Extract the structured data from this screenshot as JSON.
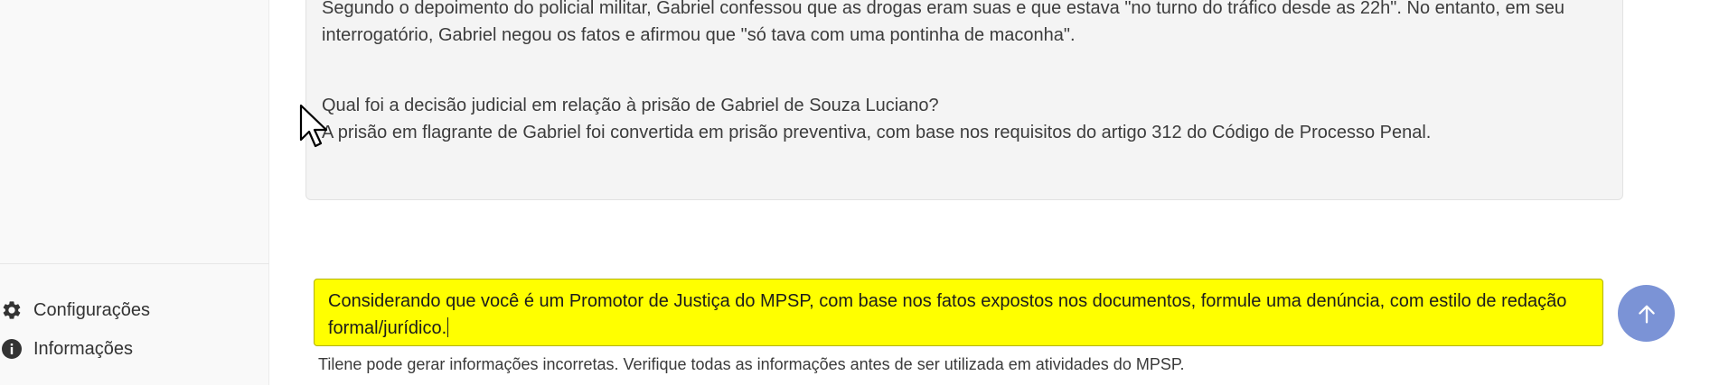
{
  "sidebar": {
    "items": [
      {
        "label": "Configurações",
        "icon": "gear-icon"
      },
      {
        "label": "Informações",
        "icon": "info-icon"
      }
    ]
  },
  "conversation": {
    "paragraph_lines": [
      "Segundo o depoimento do policial militar, Gabriel confessou que as drogas eram suas e que estava \"no turno do tráfico desde as 22h\". No entanto, em seu",
      "interrogatório, Gabriel negou os fatos e afirmou que \"só tava com uma pontinha de maconha\"."
    ],
    "question": "Qual foi a decisão judicial em relação à prisão de Gabriel de Souza Luciano?",
    "answer": "A prisão em flagrante de Gabriel foi convertida em prisão preventiva, com base nos requisitos do artigo 312 do Código de Processo Penal."
  },
  "input": {
    "value_lines": [
      "Considerando que você é um Promotor de Justiça do MPSP, com base nos fatos expostos nos documentos, formule uma denúncia, com estilo de redação",
      "formal/jurídico."
    ],
    "highlight_color": "#ffff00"
  },
  "send_button": {
    "icon": "arrow-up-icon",
    "color": "#7b93d6"
  },
  "disclaimer": "Tilene pode gerar informações incorretas. Verifique todas as informações antes de ser utilizada em atividades do MPSP."
}
